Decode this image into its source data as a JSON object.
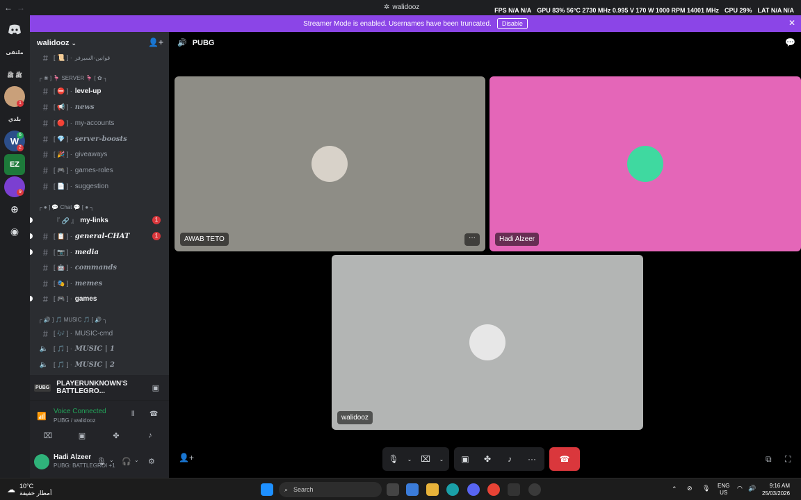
{
  "window": {
    "title": "walidooz",
    "stats": [
      "FPS N/A N/A",
      "GPU 83% 56°C 2730 MHz 0.995 V 170 W 1000 RPM 14001 MHz",
      "CPU 29%",
      "LAT N/A N/A"
    ]
  },
  "banner": {
    "text": "Streamer Mode is enabled. Usernames have been truncated.",
    "button": "Disable"
  },
  "rail": {
    "servers": [
      {
        "label": "ملتقى"
      },
      {
        "label": "ﷺ ﷺ"
      },
      {
        "label": ""
      },
      {
        "label": "بلدي"
      },
      {
        "label": "W"
      },
      {
        "label": "EZ"
      },
      {
        "label": ""
      }
    ],
    "badges": [
      "1",
      "6",
      "2",
      "9"
    ]
  },
  "sidebar": {
    "server_name": "walidooz",
    "top_partial": "قوانين-السيرفر",
    "categories": {
      "server": "┌ ❀ ] 🦩 SERVER 🦩 [ ✿ ┐",
      "chat": "┌ ● ] 💬 Chat 💬 [ ● ┐",
      "music": "┌ 🔊 ] 🎵 MUSIC 🎵 [ 🔊 ┐"
    },
    "channels": [
      {
        "deco": "[ ⛔ ] ·",
        "name": "level-up"
      },
      {
        "deco": "[ 📢 ] ·",
        "name": "news"
      },
      {
        "deco": "[ 🔴 ] ·",
        "name": "my-accounts"
      },
      {
        "deco": "[ 💎 ] ·",
        "name": "server-boosts"
      },
      {
        "deco": "[ 🎉 ] ·",
        "name": "giveaways"
      },
      {
        "deco": "[ 🎮 ] ·",
        "name": "games-roles"
      },
      {
        "deco": "[ 📄 ] ·",
        "name": "suggestion"
      },
      {
        "deco": "『 🔗 』",
        "name": "my-links",
        "mention": "1"
      },
      {
        "deco": "[ 📋 ] ·",
        "name": "general-CHAT",
        "mention": "1"
      },
      {
        "deco": "[ 📷 ] ·",
        "name": "media"
      },
      {
        "deco": "[ 🤖 ] ·",
        "name": "commands"
      },
      {
        "deco": "[ 🎭 ] ·",
        "name": "memes"
      },
      {
        "deco": "[ 🎮 ] ·",
        "name": "games"
      },
      {
        "deco": "[ 🎶 ] ·",
        "name": "MUSIC-cmd"
      },
      {
        "deco": "[ 🎵 ] ·",
        "name": "MUSIC | 1"
      },
      {
        "deco": "[ 🎵 ] ·",
        "name": "MUSIC | 2"
      }
    ],
    "activity": "PLAYERUNKNOWN'S BATTLEGRO...",
    "voice": {
      "status": "Voice Connected",
      "sub": "PUBG / walidooz"
    },
    "user": {
      "name": "Hadi Alzeer",
      "status": "PUBG: BATTLEGROI +1"
    }
  },
  "main": {
    "channel": "PUBG",
    "tiles": [
      {
        "name": "AWAB TETO",
        "bg": "#8e8d86"
      },
      {
        "name": "Hadi Alzeer",
        "bg": "#e466b8"
      },
      {
        "name": "walidooz",
        "bg": "#b3b5b4"
      }
    ]
  },
  "taskbar": {
    "weather_temp": "10°C",
    "weather_desc": "أمطار خفيفة",
    "search": "Search",
    "lang": "ENG",
    "region": "US",
    "time": "9:16 AM",
    "date": "25/03/2026"
  },
  "colors": {
    "accent": "#5865f2",
    "banner": "#8b45e7",
    "hangup": "#da373c",
    "connected": "#23a55a"
  }
}
